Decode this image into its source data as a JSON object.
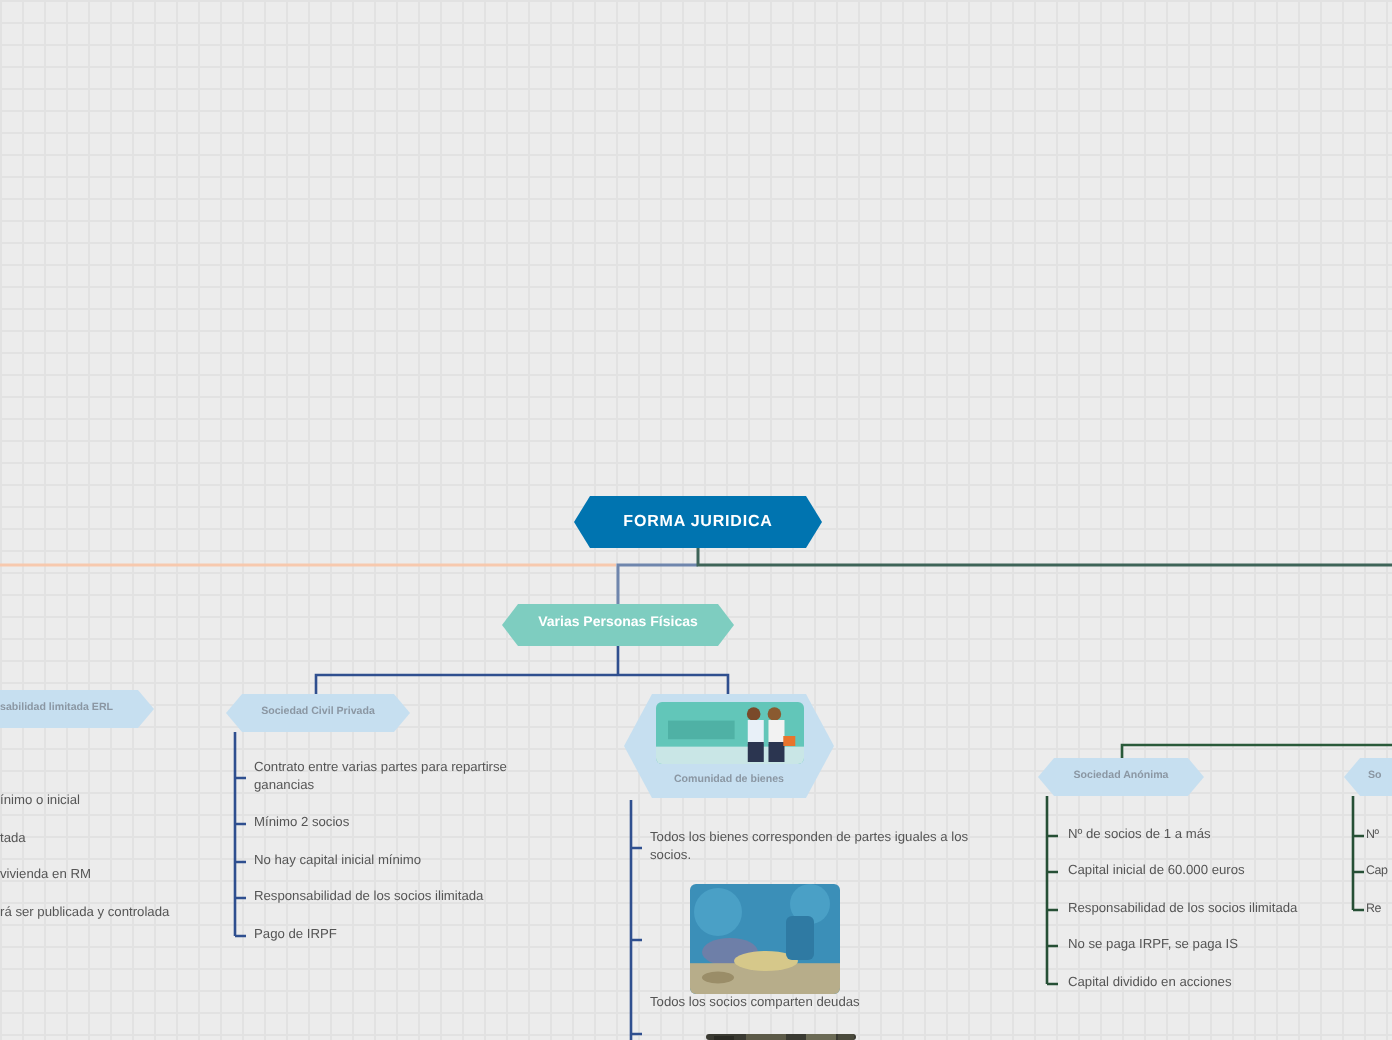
{
  "root": {
    "label": "FORMA JURIDICA"
  },
  "branch": {
    "label": "Varias Personas Físicas"
  },
  "topics": [
    {
      "kind": "plain",
      "label": "sabilidad limitada ERL",
      "items": [
        {
          "kind": "text",
          "text": "ínimo o inicial"
        },
        {
          "kind": "text",
          "text": "tada"
        },
        {
          "kind": "text",
          "text": "vivienda en RM"
        },
        {
          "kind": "text",
          "text": "rá ser publicada y controlada"
        }
      ]
    },
    {
      "kind": "plain",
      "label": "Sociedad Civil Privada",
      "items": [
        {
          "kind": "text",
          "text": "Contrato entre varias partes para repartirse ganancias"
        },
        {
          "kind": "text",
          "text": "Mínimo 2 socios"
        },
        {
          "kind": "text",
          "text": "No hay capital inicial mínimo"
        },
        {
          "kind": "text",
          "text": "Responsabilidad de los socios ilimitada"
        },
        {
          "kind": "text",
          "text": "Pago de IRPF"
        }
      ]
    },
    {
      "kind": "illustrated",
      "label": "Comunidad de bienes",
      "items": [
        {
          "kind": "text",
          "text": "Todos los bienes corresponden de partes iguales a los socios."
        },
        {
          "kind": "picture",
          "caption": "Todos los socios comparten deudas"
        },
        {
          "kind": "picture"
        }
      ]
    },
    {
      "kind": "plain",
      "label": "Sociedad Anónima",
      "items": [
        {
          "kind": "text",
          "text": "Nº de socios de 1 a más"
        },
        {
          "kind": "text",
          "text": "Capital inicial de 60.000 euros"
        },
        {
          "kind": "text",
          "text": "Responsabilidad de los socios ilimitada"
        },
        {
          "kind": "text",
          "text": "No se paga IRPF, se paga IS"
        },
        {
          "kind": "text",
          "text": "Capital dividido en acciones"
        }
      ]
    },
    {
      "kind": "plain",
      "label": "So",
      "items": [
        {
          "kind": "text",
          "text": "Nº"
        },
        {
          "kind": "text",
          "text": "Cap"
        },
        {
          "kind": "text",
          "text": "Re"
        }
      ]
    }
  ]
}
